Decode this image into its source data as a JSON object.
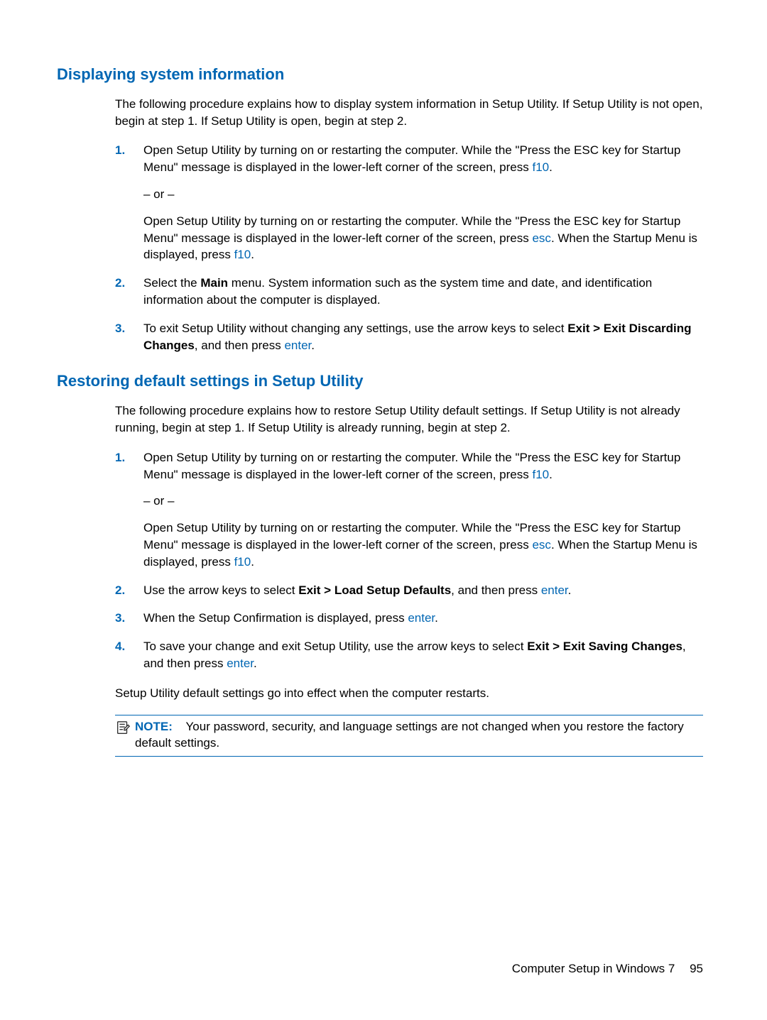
{
  "section1": {
    "heading": "Displaying system information",
    "intro": "The following procedure explains how to display system information in Setup Utility. If Setup Utility is not open, begin at step 1. If Setup Utility is open, begin at step 2.",
    "step1": {
      "num": "1.",
      "p1a": "Open Setup Utility by turning on or restarting the computer. While the \"Press the ESC key for Startup Menu\" message is displayed in the lower-left corner of the screen, press ",
      "p1key": "f10",
      "p1b": ".",
      "or": "– or –",
      "p2a": "Open Setup Utility by turning on or restarting the computer. While the \"Press the ESC key for Startup Menu\" message is displayed in the lower-left corner of the screen, press ",
      "p2key1": "esc",
      "p2b": ". When the Startup Menu is displayed, press ",
      "p2key2": "f10",
      "p2c": "."
    },
    "step2": {
      "num": "2.",
      "a": "Select the ",
      "bold": "Main",
      "b": " menu. System information such as the system time and date, and identification information about the computer is displayed."
    },
    "step3": {
      "num": "3.",
      "a": "To exit Setup Utility without changing any settings, use the arrow keys to select ",
      "bold": "Exit > Exit Discarding Changes",
      "b": ", and then press ",
      "key": "enter",
      "c": "."
    }
  },
  "section2": {
    "heading": "Restoring default settings in Setup Utility",
    "intro": "The following procedure explains how to restore Setup Utility default settings. If Setup Utility is not already running, begin at step 1. If Setup Utility is already running, begin at step 2.",
    "step1": {
      "num": "1.",
      "p1a": "Open Setup Utility by turning on or restarting the computer. While the \"Press the ESC key for Startup Menu\" message is displayed in the lower-left corner of the screen, press ",
      "p1key": "f10",
      "p1b": ".",
      "or": "– or –",
      "p2a": "Open Setup Utility by turning on or restarting the computer. While the \"Press the ESC key for Startup Menu\" message is displayed in the lower-left corner of the screen, press ",
      "p2key1": "esc",
      "p2b": ". When the Startup Menu is displayed, press ",
      "p2key2": "f10",
      "p2c": "."
    },
    "step2": {
      "num": "2.",
      "a": "Use the arrow keys to select ",
      "bold": "Exit > Load Setup Defaults",
      "b": ", and then press ",
      "key": "enter",
      "c": "."
    },
    "step3": {
      "num": "3.",
      "a": "When the Setup Confirmation is displayed, press ",
      "key": "enter",
      "b": "."
    },
    "step4": {
      "num": "4.",
      "a": "To save your change and exit Setup Utility, use the arrow keys to select ",
      "bold": "Exit > Exit Saving Changes",
      "b": ", and then press ",
      "key": "enter",
      "c": "."
    },
    "closing": "Setup Utility default settings go into effect when the computer restarts."
  },
  "note": {
    "label": "NOTE:",
    "text": "Your password, security, and language settings are not changed when you restore the factory default settings."
  },
  "footer": {
    "text": "Computer Setup in Windows 7",
    "page": "95"
  }
}
